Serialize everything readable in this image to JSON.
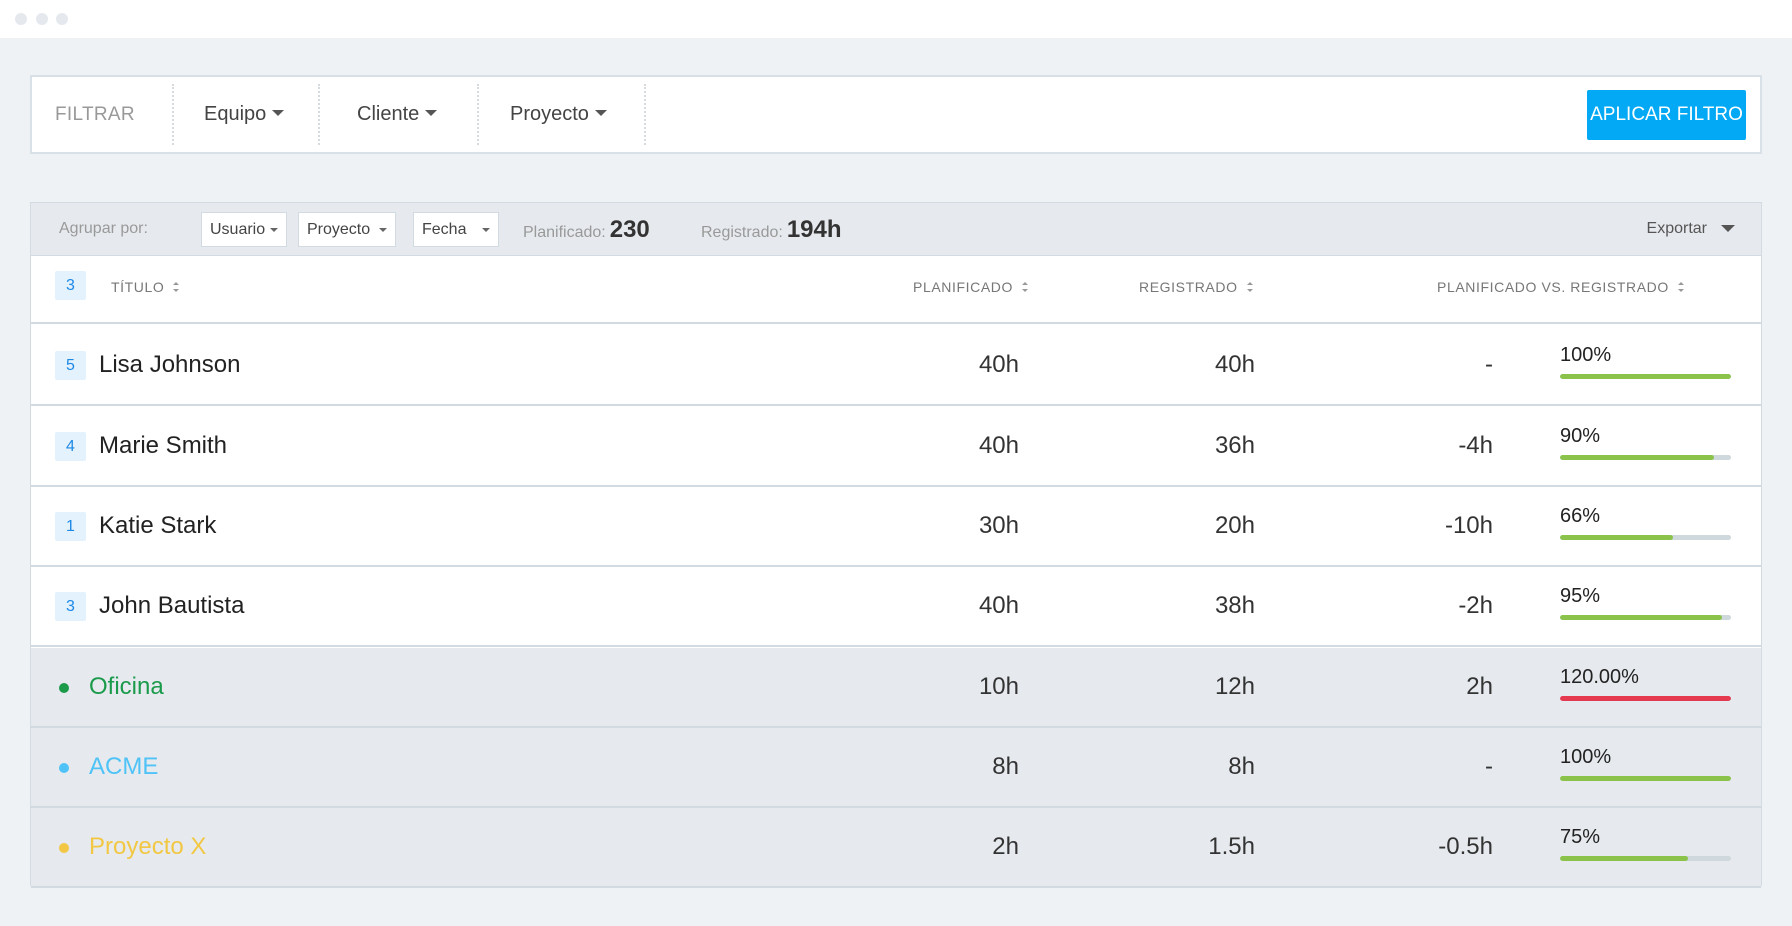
{
  "window": {
    "dots": [
      "#e5e9ee",
      "#e5e9ee",
      "#e5e9ee"
    ]
  },
  "filter": {
    "label": "FILTRAR",
    "dropdowns": [
      "Equipo",
      "Cliente",
      "Proyecto"
    ],
    "apply_label": "APLICAR FILTRO",
    "apply_color": "#03a9f4"
  },
  "toolbar": {
    "group_by_label": "Agrupar por:",
    "selects": [
      "Usuario",
      "Proyecto",
      "Fecha"
    ],
    "planned_label": "Planificado:",
    "planned_value": "230",
    "logged_label": "Registrado:",
    "logged_value": "194h",
    "export_label": "Exportar"
  },
  "table": {
    "count": "3",
    "columns": {
      "title": "TÍTULO",
      "planned": "PLANIFICADO",
      "logged": "REGISTRADO",
      "vs": "PLANIFICADO VS. REGISTRADO"
    },
    "users": [
      {
        "count": "5",
        "name": "Lisa Johnson",
        "planned": "40h",
        "logged": "40h",
        "diff": "-",
        "pct": "100%",
        "progress": 1.0
      },
      {
        "count": "4",
        "name": "Marie Smith",
        "planned": "40h",
        "logged": "36h",
        "diff": "-4h",
        "pct": "90%",
        "progress": 0.9
      },
      {
        "count": "1",
        "name": "Katie Stark",
        "planned": "30h",
        "logged": "20h",
        "diff": "-10h",
        "pct": "66%",
        "progress": 0.66
      },
      {
        "count": "3",
        "name": "John Bautista",
        "planned": "40h",
        "logged": "38h",
        "diff": "-2h",
        "pct": "95%",
        "progress": 0.95
      }
    ],
    "projects": [
      {
        "name": "Oficina",
        "color": "#1a9a4a",
        "planned": "10h",
        "logged": "12h",
        "diff": "2h",
        "pct": "120.00%",
        "progress": 1.0,
        "bar_color": "#e53950"
      },
      {
        "name": "ACME",
        "color": "#4fc3f7",
        "planned": "8h",
        "logged": "8h",
        "diff": "-",
        "pct": "100%",
        "progress": 1.0,
        "bar_color": "#8bc34a"
      },
      {
        "name": "Proyecto X",
        "color": "#f2c744",
        "planned": "2h",
        "logged": "1.5h",
        "diff": "-0.5h",
        "pct": "75%",
        "progress": 0.75,
        "bar_color": "#8bc34a"
      }
    ],
    "progress_color": "#8bc34a"
  }
}
